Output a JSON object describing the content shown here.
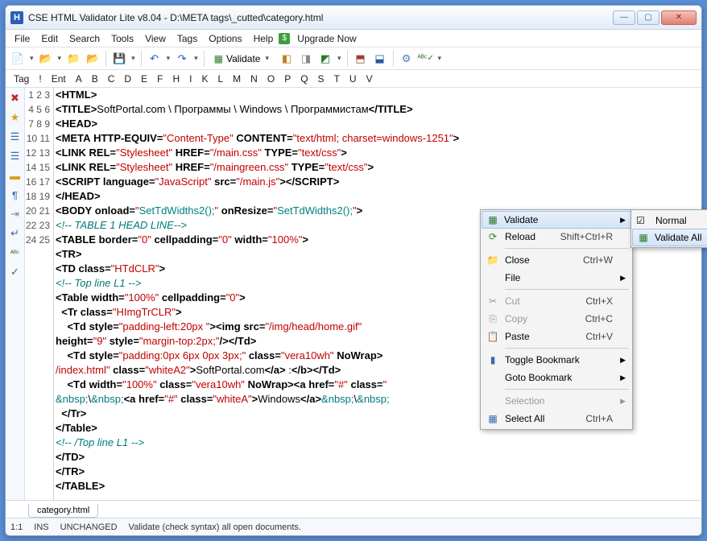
{
  "title": "CSE HTML Validator Lite v8.04 - D:\\META tags\\_cutted\\category.html",
  "menu": [
    "File",
    "Edit",
    "Search",
    "Tools",
    "View",
    "Tags",
    "Options",
    "Help"
  ],
  "upgrade": "Upgrade Now",
  "validate_label": "Validate",
  "tagbar": [
    "Tag",
    "!",
    "Ent",
    "A",
    "B",
    "C",
    "D",
    "E",
    "F",
    "H",
    "I",
    "K",
    "L",
    "M",
    "N",
    "O",
    "P",
    "Q",
    "S",
    "T",
    "U",
    "V"
  ],
  "lines": 25,
  "tab": "category.html",
  "status": {
    "pos": "1:1",
    "ins": "INS",
    "state": "UNCHANGED",
    "msg": "Validate (check syntax) all open documents."
  },
  "ctx": {
    "validate": "Validate",
    "reload": "Reload",
    "reload_sc": "Shift+Ctrl+R",
    "close": "Close",
    "close_sc": "Ctrl+W",
    "file": "File",
    "cut": "Cut",
    "cut_sc": "Ctrl+X",
    "copy": "Copy",
    "copy_sc": "Ctrl+C",
    "paste": "Paste",
    "paste_sc": "Ctrl+V",
    "toggle": "Toggle Bookmark",
    "goto": "Goto Bookmark",
    "selection": "Selection",
    "selectall": "Select All",
    "selectall_sc": "Ctrl+A",
    "normal": "Normal",
    "validateall": "Validate All"
  }
}
